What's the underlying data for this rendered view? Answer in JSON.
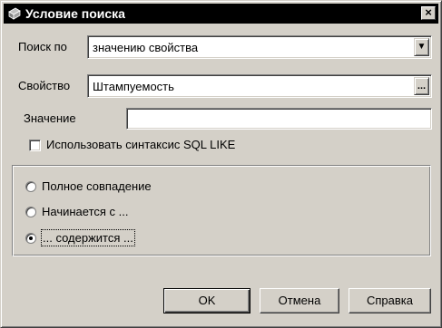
{
  "window": {
    "title": "Условие поиска",
    "close_label": "×"
  },
  "form": {
    "search_by_label": "Поиск по",
    "search_by_value": "значению свойства",
    "property_label": "Свойство",
    "property_value": "Штампуемость",
    "property_browse": "...",
    "value_label": "Значение",
    "value_value": "",
    "sql_like_checkbox": {
      "label": "Использовать синтаксис SQL LIKE",
      "checked": false
    }
  },
  "match_mode": {
    "options": [
      {
        "label": "Полное совпадение",
        "selected": false
      },
      {
        "label": "Начинается с ...",
        "selected": false
      },
      {
        "label": "... содержится ...",
        "selected": true
      }
    ]
  },
  "buttons": {
    "ok": "OK",
    "cancel": "Отмена",
    "help": "Справка"
  }
}
